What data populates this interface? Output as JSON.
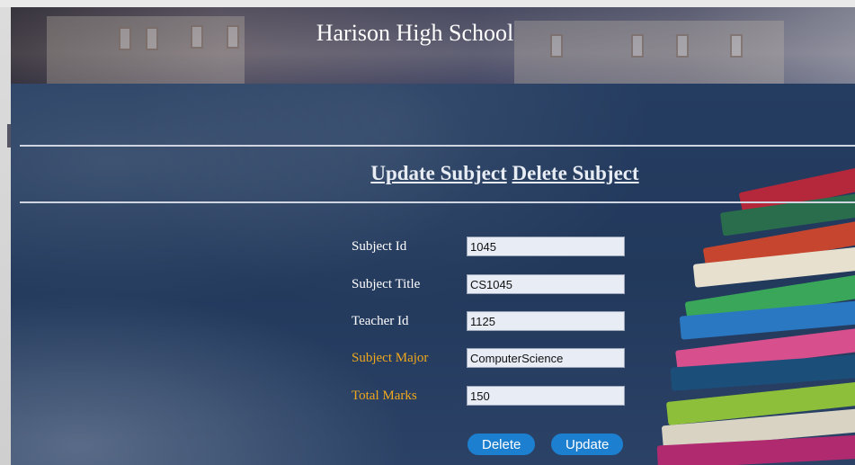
{
  "header": {
    "title": "Harison High School"
  },
  "nav": {
    "update_label": "Update Subject",
    "delete_label": "Delete Subject"
  },
  "form": {
    "fields": [
      {
        "label": "Subject Id",
        "value": "1045",
        "highlight": false
      },
      {
        "label": "Subject Title",
        "value": "CS1045",
        "highlight": false
      },
      {
        "label": "Teacher Id",
        "value": "1125",
        "highlight": false
      },
      {
        "label": "Subject Major",
        "value": "ComputerScience",
        "highlight": true
      },
      {
        "label": "Total Marks",
        "value": "150",
        "highlight": true
      }
    ],
    "delete_button": "Delete",
    "update_button": "Update"
  },
  "colors": {
    "background": "#22395c",
    "label_gold": "#f0a81c",
    "button": "#1d7fd0"
  }
}
